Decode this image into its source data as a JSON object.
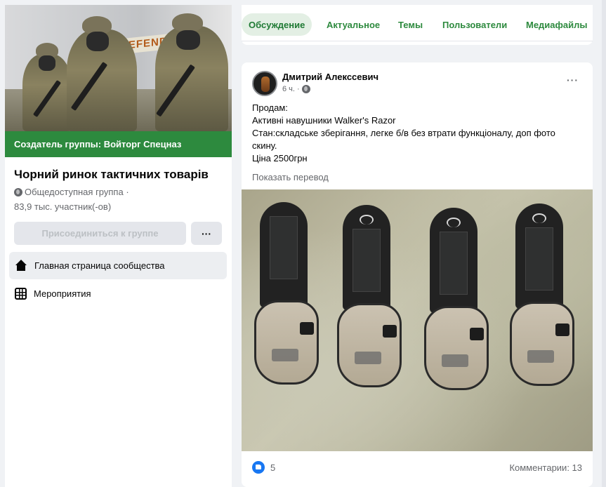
{
  "group": {
    "creator_banner": "Создатель группы: Войторг Спецназ",
    "name": "Чорний ринок тактичних товарів",
    "privacy": "Общедоступная группа ·",
    "members": "83,9 тыс. участник(-ов)",
    "join_label": "Присоединиться к группе",
    "more_label": "···",
    "cover_sign_text": "DEFENDER"
  },
  "sidebar": {
    "items": [
      {
        "label": "Главная страница сообщества",
        "icon": "home-icon",
        "active": true
      },
      {
        "label": "Мероприятия",
        "icon": "calendar-icon",
        "active": false
      }
    ]
  },
  "tabs": [
    {
      "label": "Обсуждение",
      "active": true
    },
    {
      "label": "Актуальное",
      "active": false
    },
    {
      "label": "Темы",
      "active": false
    },
    {
      "label": "Пользователи",
      "active": false
    },
    {
      "label": "Медиафайлы",
      "active": false
    }
  ],
  "post": {
    "author": "Дмитрий Алекссевич",
    "time": "6 ч. ·",
    "lines": [
      "Продам:",
      "Активні навушники Walker's Razor",
      "Стан:складське зберігання, легке б/в без втрати функціоналу, доп фото скину.",
      "Ціна 2500грн"
    ],
    "translate": "Показать перевод",
    "likes": "5",
    "comments": "Комментарии: 13",
    "menu": "···"
  },
  "colors": {
    "brand_green": "#2d8a3e",
    "like_blue": "#1877f2"
  }
}
